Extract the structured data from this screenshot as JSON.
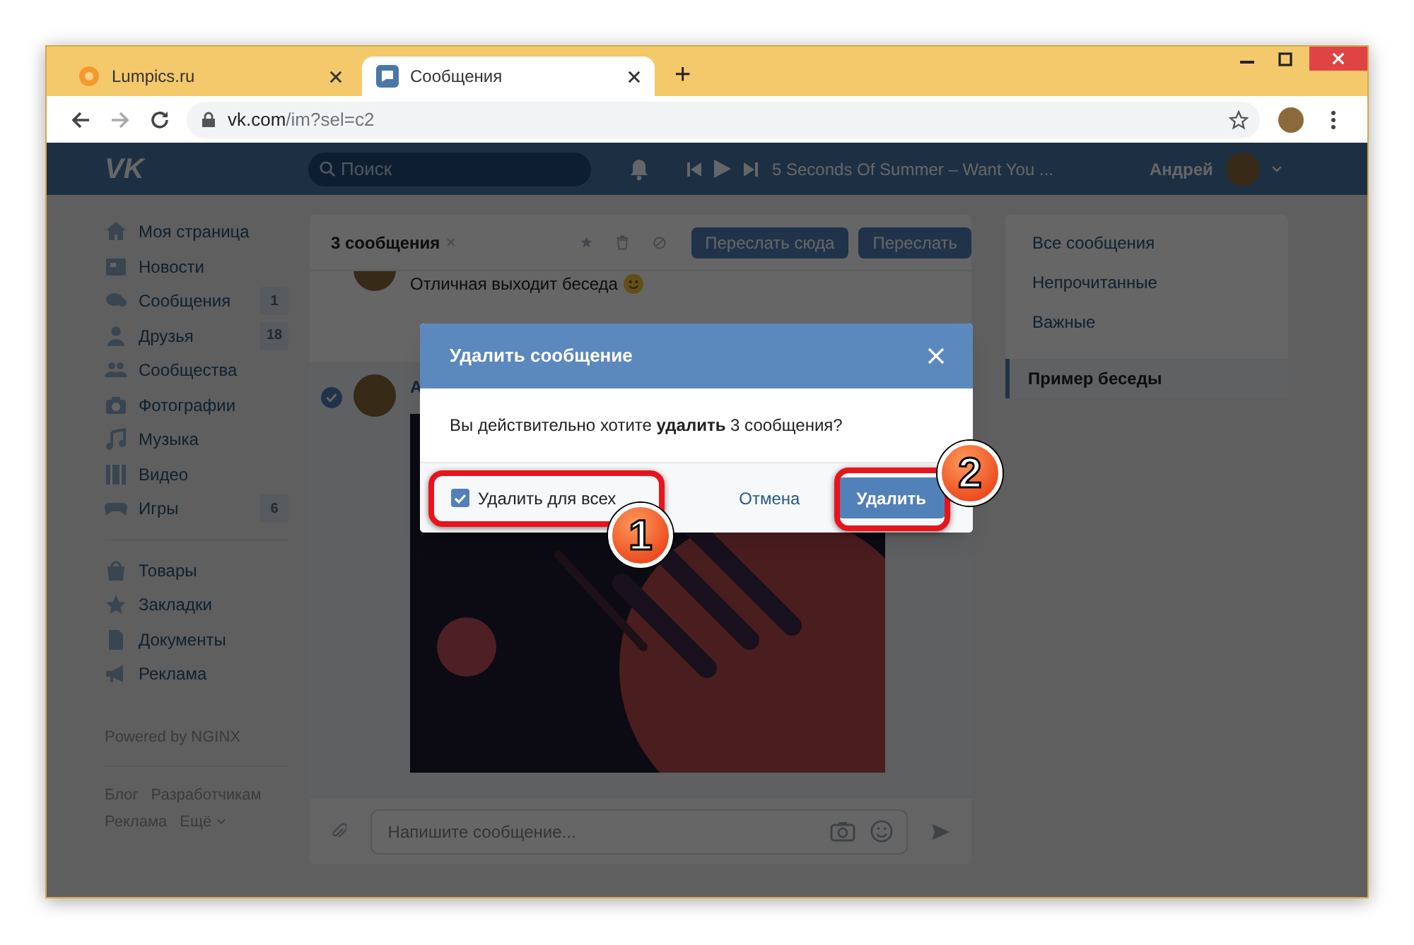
{
  "browser": {
    "tabs": [
      {
        "title": "Lumpics.ru",
        "selected": false
      },
      {
        "title": "Сообщения",
        "selected": true
      }
    ],
    "new_tab": "+",
    "address": {
      "host": "vk.com",
      "path": "/im?sel=c2"
    }
  },
  "header": {
    "logo": "VK",
    "search": {
      "placeholder": "Поиск"
    },
    "player": {
      "track": "5 Seconds Of Summer – Want You ..."
    },
    "user_name": "Андрей"
  },
  "sidebar": {
    "items": [
      {
        "label": "Моя страница"
      },
      {
        "label": "Новости"
      },
      {
        "label": "Сообщения",
        "count": "1"
      },
      {
        "label": "Друзья",
        "count": "18"
      },
      {
        "label": "Сообщества"
      },
      {
        "label": "Фотографии"
      },
      {
        "label": "Музыка"
      },
      {
        "label": "Видео"
      },
      {
        "label": "Игры",
        "count": "6"
      }
    ],
    "extra_items": [
      {
        "label": "Товары"
      },
      {
        "label": "Закладки"
      },
      {
        "label": "Документы"
      },
      {
        "label": "Реклама"
      }
    ],
    "powered_by": "Powered by NGINX",
    "footer_links": [
      "Блог",
      "Разработчикам",
      "Реклама",
      "Ещё"
    ]
  },
  "chat": {
    "selection": "3 сообщения",
    "buttons": [
      "Переслать сюда",
      "Переслать"
    ],
    "messages": [
      {
        "text": "Отличная выходит беседа",
        "selected": false
      },
      {
        "author": "А",
        "selected": true
      }
    ],
    "composer": {
      "placeholder": "Напишите сообщение..."
    }
  },
  "folders": {
    "items": [
      {
        "label": "Все сообщения",
        "selected": false
      },
      {
        "label": "Непрочитанные",
        "selected": false
      },
      {
        "label": "Важные",
        "selected": false
      }
    ],
    "conversations": [
      {
        "label": "Пример беседы",
        "selected": true
      }
    ]
  },
  "dialog": {
    "title": "Удалить сообщение",
    "text": "Вы действительно хотите **удалить** 3 сообщения?",
    "checkbox": {
      "label": "Удалить для всех",
      "checked": true
    },
    "cancel": "Отмена",
    "confirm": "Удалить"
  },
  "annotations": [
    {
      "number": "1"
    },
    {
      "number": "2"
    }
  ]
}
